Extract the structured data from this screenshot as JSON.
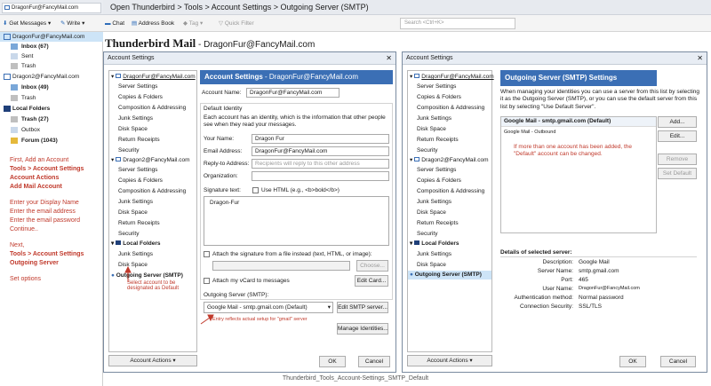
{
  "toolbar": {
    "account_tab": "DragonFur@FancyMail.com",
    "get_messages": "Get Messages",
    "write": "Write",
    "chat": "Chat",
    "address_book": "Address Book",
    "tag": "Tag",
    "quick_filter": "Quick Filter",
    "search_placeholder": "Search <Ctrl+K>",
    "window_title": "Open Thunderbird > Tools > Account Settings > Outgoing Server (SMTP)"
  },
  "folders": {
    "account1": "DragonFur@FancyMail.com",
    "inbox1": "Inbox (67)",
    "sent1": "Sent",
    "trash1": "Trash",
    "account2": "Dragon2@FancyMail.com",
    "inbox2": "Inbox (49)",
    "trash2": "Trash",
    "local": "Local Folders",
    "ltrash": "Trash (27)",
    "outbox": "Outbox",
    "forum": "Forum (1043)"
  },
  "instructions": {
    "l1": "First, Add an Account",
    "l2": "Tools > Account Settings",
    "l3": "Account Actions",
    "l4": "Add Mail Account",
    "l5": "Enter your Display Name",
    "l6": "Enter the email address",
    "l7": "Enter the email password",
    "l8": "Continue..",
    "l9": "Next,",
    "l10": "Tools > Account Settings",
    "l11": "Outgoing Server",
    "l12": "Set options"
  },
  "main": {
    "title": "Thunderbird Mail",
    "title_sep": " - ",
    "title_email": "DragonFur@FancyMail.com"
  },
  "left_dialog": {
    "title": "Account Settings",
    "tree": {
      "account1": "DragonFur@FancyMail.com",
      "server_settings": "Server Settings",
      "copies": "Copies & Folders",
      "composition": "Composition & Addressing",
      "junk": "Junk Settings",
      "disk": "Disk Space",
      "receipts": "Return Receipts",
      "security": "Security",
      "account2": "Dragon2@FancyMail.com",
      "server_settings2": "Server Settings",
      "copies2": "Copies & Folders",
      "composition2": "Composition & Addressing",
      "junk2": "Junk Settings",
      "disk2": "Disk Space",
      "receipts2": "Return Receipts",
      "security2": "Security",
      "local": "Local Folders",
      "junk3": "Junk Settings",
      "disk3": "Disk Space",
      "outgoing": "Outgoing Server (SMTP)"
    },
    "annot_select": "Select account to be designated as Default",
    "account_actions": "Account Actions",
    "header": "Account Settings",
    "header_email": "DragonFur@FancyMail.com",
    "account_name_label": "Account Name:",
    "account_name_value": "DragonFur@FancyMail.com",
    "default_identity": "Default Identity",
    "identity_desc": "Each account has an identity, which is the information that other people see when they read your messages.",
    "your_name_label": "Your Name:",
    "your_name_value": "Dragon Fur",
    "email_label": "Email Address:",
    "email_value": "DragonFur@FancyMail.com",
    "reply_label": "Reply-to Address:",
    "reply_placeholder": "Recipients will reply to this other address",
    "org_label": "Organization:",
    "sig_label": "Signature text:",
    "use_html": "Use HTML (e.g., <b>bold</b>)",
    "sig_value": "Dragon-Fur",
    "attach_sig": "Attach the signature from a file instead (text, HTML, or image):",
    "choose": "Choose...",
    "attach_vcard": "Attach my vCard to messages",
    "edit_card": "Edit Card...",
    "outgoing_label": "Outgoing Server (SMTP):",
    "outgoing_value": "Google Mail - smtp.gmail.com (Default)",
    "edit_smtp": "Edit SMTP server...",
    "annot_entry": "Entry reflects actual setup for \"gmail\" server",
    "manage_identities": "Manage Identities...",
    "ok": "OK",
    "cancel": "Cancel"
  },
  "right_dialog": {
    "title": "Account Settings",
    "tree": {
      "account1": "DragonFur@FancyMail.com",
      "server_settings": "Server Settings",
      "copies": "Copies & Folders",
      "composition": "Composition & Addressing",
      "junk": "Junk Settings",
      "disk": "Disk Space",
      "receipts": "Return Receipts",
      "security": "Security",
      "account2": "Dragon2@FancyMail.com",
      "server_settings2": "Server Settings",
      "copies2": "Copies & Folders",
      "composition2": "Composition & Addressing",
      "junk2": "Junk Settings",
      "disk2": "Disk Space",
      "receipts2": "Return Receipts",
      "security2": "Security",
      "local": "Local Folders",
      "junk3": "Junk Settings",
      "disk3": "Disk Space",
      "outgoing": "Outgoing Server (SMTP)"
    },
    "account_actions": "Account Actions",
    "header": "Outgoing Server (SMTP) Settings",
    "desc": "When managing your identities you can use a server from this list by selecting it as the Outgoing Server (SMTP), or you can use the default server from this list by selecting \"Use Default Server\".",
    "server_item": "Google Mail - smtp.gmail.com (Default)",
    "server_item2": "Google Mail - Outbound",
    "annot_note": "If more than one account has been added, the \"Default\" account can be changed.",
    "add": "Add...",
    "edit": "Edit...",
    "remove": "Remove",
    "set_default": "Set Default",
    "details_title": "Details of selected server:",
    "details": {
      "description_label": "Description:",
      "description": "Google Mail",
      "server_name_label": "Server Name:",
      "server_name": "smtp.gmail.com",
      "port_label": "Port:",
      "port": "465",
      "user_name_label": "User Name:",
      "user_name": "DragonFur@FancyMail.com",
      "auth_label": "Authentication method:",
      "auth": "Normal password",
      "security_label": "Connection Security:",
      "security": "SSL/TLS"
    },
    "ok": "OK",
    "cancel": "Cancel"
  },
  "caption": "Thunderbird_Tools_Account-Settings_SMTP_Default"
}
